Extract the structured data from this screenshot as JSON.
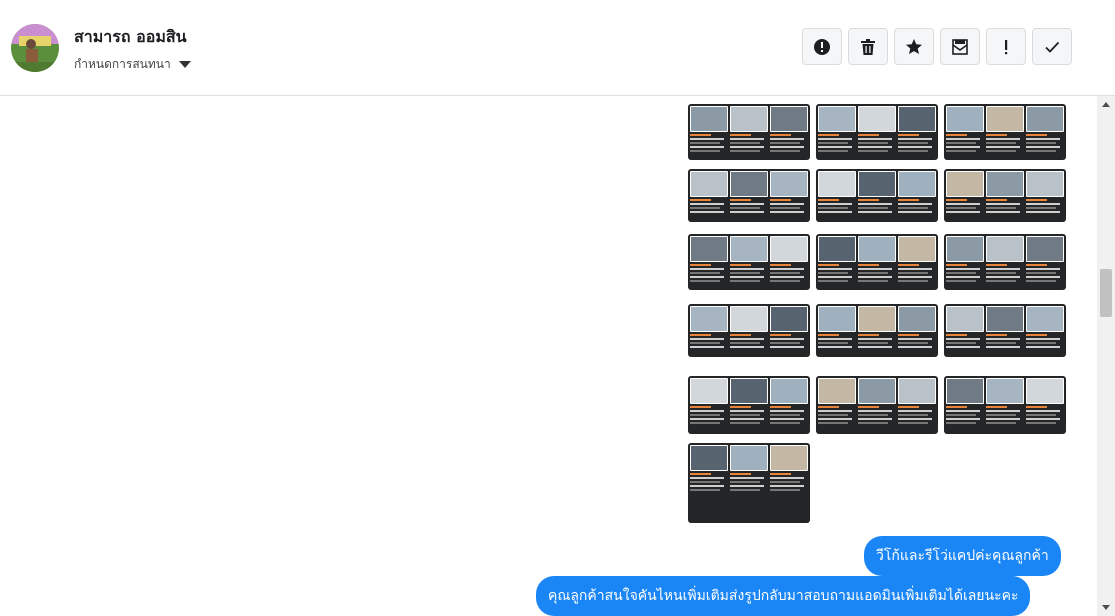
{
  "header": {
    "contact_name": "สามารถ ออมสิน",
    "conversation_settings": "กำหนดการสนทนา",
    "actions": [
      {
        "name": "report-button",
        "icon": "alert-circle-icon"
      },
      {
        "name": "delete-button",
        "icon": "trash-icon"
      },
      {
        "name": "star-button",
        "icon": "star-icon"
      },
      {
        "name": "mark-unread-button",
        "icon": "envelope-icon"
      },
      {
        "name": "important-button",
        "icon": "exclamation-icon"
      },
      {
        "name": "done-button",
        "icon": "check-icon"
      }
    ]
  },
  "shared_images_count": 16,
  "messages": [
    {
      "text": "วีโก้และรีโว่แคปค่ะคุณลูกค้า"
    },
    {
      "text": "คุณลูกค้าสนใจคันไหนเพิ่มเติมส่งรูปกลับมาสอบถามแอดมินเพิ่มเติมได้เลยนะคะ"
    }
  ],
  "colors": {
    "bubble": "#1a85f5",
    "thumbnail_bg": "#242526",
    "price_text": "#e8843a"
  }
}
